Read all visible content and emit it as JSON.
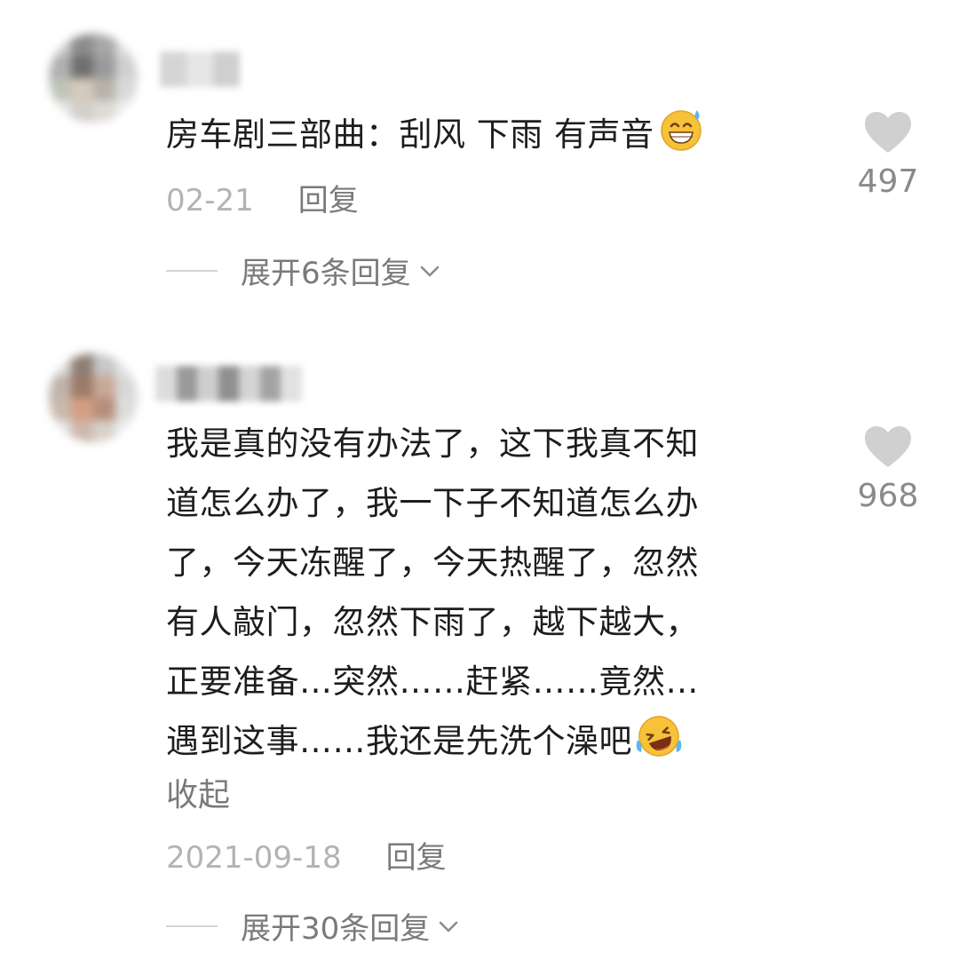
{
  "comments": [
    {
      "text_lines": [
        "房车剧三部曲：刮风 下雨 有声音"
      ],
      "emoji": "grinning-sweat-emoji",
      "date": "02-21",
      "reply_label": "回复",
      "like_count": "497",
      "expand_label": "展开6条回复"
    },
    {
      "text_lines": [
        "我是真的没有办法了，这下我真不知",
        "道怎么办了，我一下子不知道怎么办",
        "了，今天冻醒了，今天热醒了，忽然",
        "有人敲门，忽然下雨了，越下越大，",
        "正要准备…突然……赶紧……竟然…",
        "遇到这事……我还是先洗个澡吧"
      ],
      "emoji": "laughing-tears-emoji",
      "collapse_label": "收起",
      "date": "2021-09-18",
      "reply_label": "回复",
      "like_count": "968",
      "expand_label": "展开30条回复"
    }
  ],
  "colors": {
    "text": "#1d1d1d",
    "meta": "#b3b3b3",
    "link": "#7a7a7a",
    "heart": "#d0d0d0"
  }
}
